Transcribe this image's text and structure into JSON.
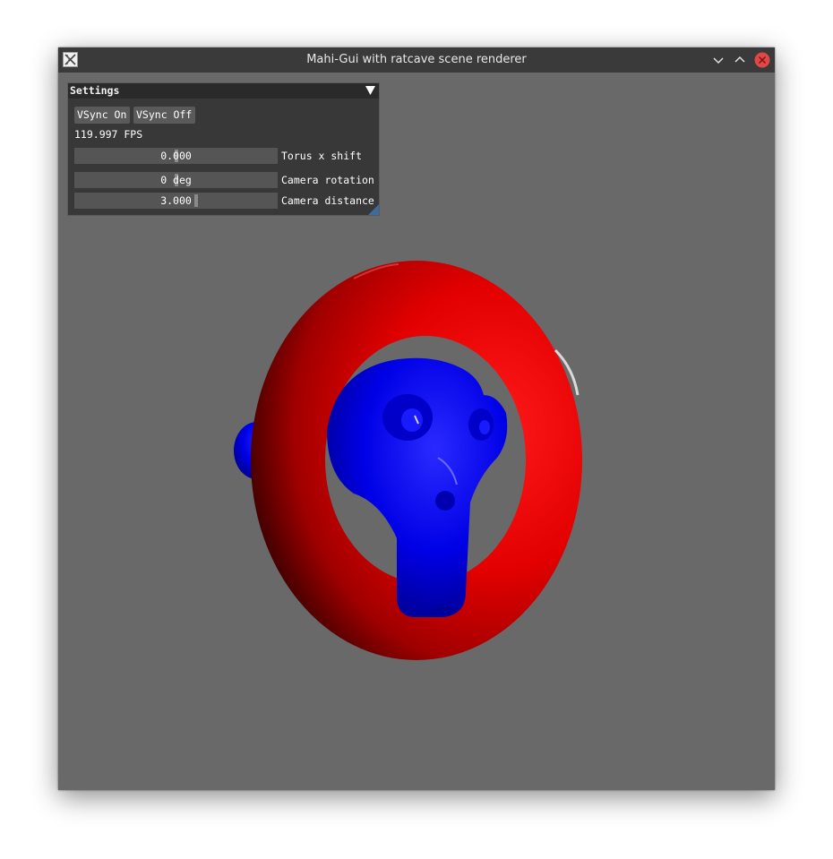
{
  "window": {
    "title": "Mahi-Gui with ratcave scene renderer",
    "icon": "x-app-icon",
    "controls": [
      "minimize-icon",
      "maximize-icon",
      "close-icon"
    ]
  },
  "settings": {
    "title": "Settings",
    "vsync_on_label": "VSync On",
    "vsync_off_label": "VSync Off",
    "fps_text": "119.997 FPS",
    "sliders": [
      {
        "value": "0.000",
        "label": "Torus x shift",
        "position": 0.5
      },
      {
        "value": "0 deg",
        "label": "Camera rotation",
        "position": 0.5
      },
      {
        "value": "3.000",
        "label": "Camera distance",
        "position": 0.6
      }
    ]
  },
  "scene": {
    "background_color": "#696969",
    "torus_color": "#e00000",
    "monkey_color": "#0000e0"
  }
}
